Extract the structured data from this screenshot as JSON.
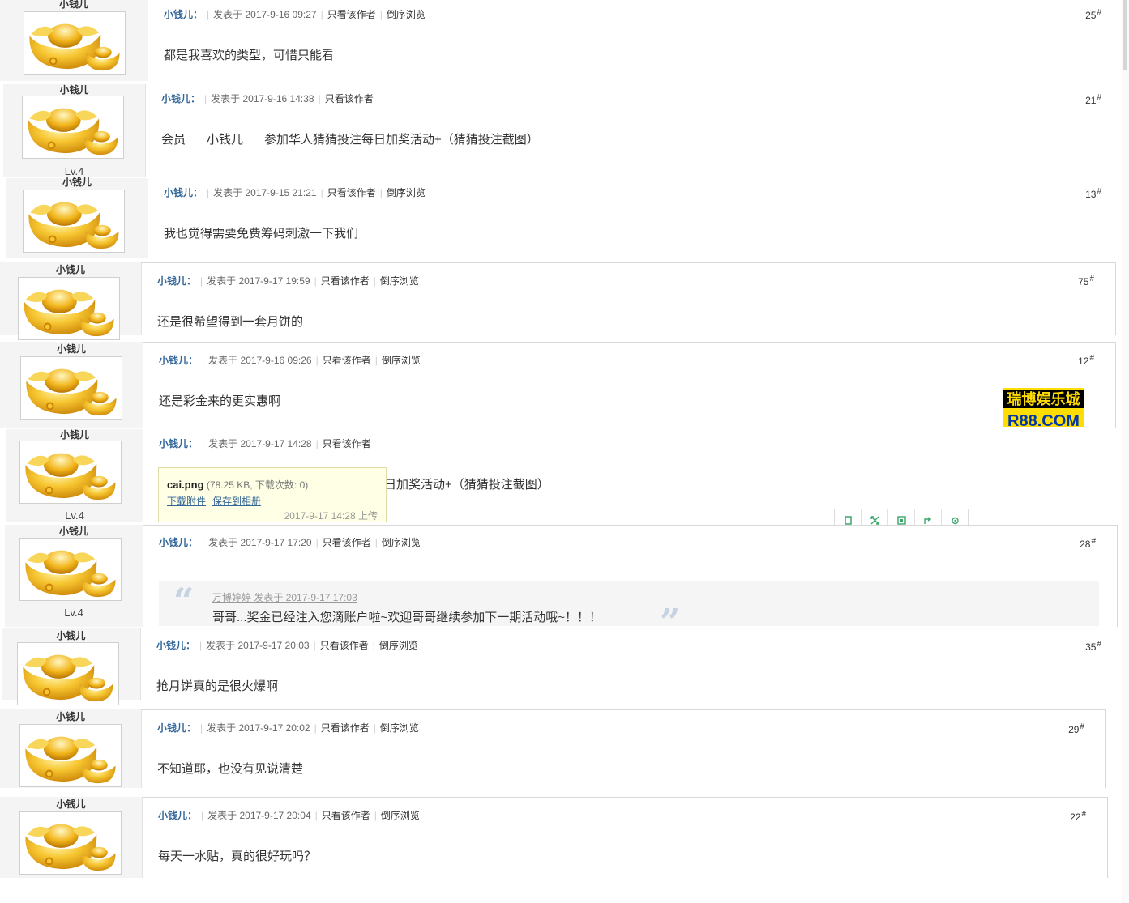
{
  "colors": {
    "author": "#336699",
    "gold": "#f2b51a",
    "sidebar": "#f4f4f4"
  },
  "labels": {
    "author_suffix": "小钱儿：",
    "only_author": "只看该作者",
    "reverse": "倒序浏览"
  },
  "posts": [
    {
      "author": "小钱儿",
      "date": "发表于 2017-9-16 09:27",
      "floor": "25",
      "content": "都是我喜欢的类型，可惜只能看"
    },
    {
      "author": "小钱儿",
      "date": "发表于 2017-9-16 14:38",
      "floor": "21",
      "level": "Lv.4",
      "content_parts": [
        "会员",
        "小钱儿",
        "参加华人猜猜投注每日加奖活动+（猜猜投注截图）"
      ]
    },
    {
      "author": "小钱儿",
      "date": "发表于 2017-9-15 21:21",
      "floor": "13",
      "content": "我也觉得需要免费筹码刺激一下我们"
    },
    {
      "author": "小钱儿",
      "date": "发表于 2017-9-17 19:59",
      "floor": "75",
      "content": "还是很希望得到一套月饼的"
    },
    {
      "author": "小钱儿",
      "date": "发表于 2017-9-16 09:26",
      "floor": "12",
      "content": "还是彩金来的更实惠啊"
    },
    {
      "author": "小钱儿",
      "date": "发表于 2017-9-17 14:28",
      "level": "Lv.4",
      "content": "日加奖活动+（猜猜投注截图）"
    },
    {
      "author": "小钱儿",
      "date": "发表于 2017-9-17 17:20",
      "floor": "28",
      "level": "Lv.4",
      "quote": {
        "author": "万博婷婷",
        "date": "发表于 2017-9-17 17:03",
        "text": "哥哥...奖金已经注入您滴账户啦~欢迎哥哥继续参加下一期活动哦~！！！"
      }
    },
    {
      "author": "小钱儿",
      "date": "发表于 2017-9-17 20:03",
      "floor": "35",
      "content": "抢月饼真的是很火爆啊"
    },
    {
      "author": "小钱儿",
      "date": "发表于 2017-9-17 20:02",
      "floor": "29",
      "content": "不知道耶，也没有见说清楚"
    },
    {
      "author": "小钱儿",
      "date": "发表于 2017-9-17 20:04",
      "floor": "22",
      "content": "每天一水贴，真的很好玩吗？"
    }
  ],
  "attachment": {
    "filename": "cai.png",
    "info": "(78.25 KB, 下载次数: 0)",
    "download": "下载附件",
    "save": "保存到相册",
    "uploaded": "2017-9-17 14:28 上传"
  },
  "toolbar_icons": [
    "square-icon",
    "expand-icon",
    "frame-icon",
    "share-icon",
    "gear-icon"
  ],
  "ad": {
    "line1": "瑞博娱乐城",
    "line2": "R88.COM"
  }
}
